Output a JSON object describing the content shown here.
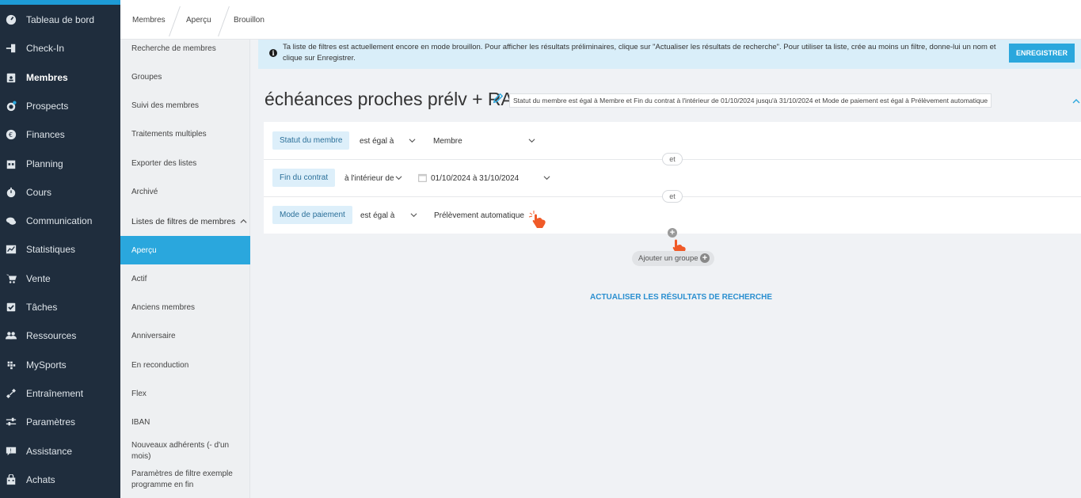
{
  "sidebar": {
    "items": [
      {
        "label": "Tableau de bord",
        "icon": "gauge-icon"
      },
      {
        "label": "Check-In",
        "icon": "login-icon"
      },
      {
        "label": "Membres",
        "icon": "id-card-icon",
        "active": true
      },
      {
        "label": "Prospects",
        "icon": "target-icon"
      },
      {
        "label": "Finances",
        "icon": "euro-icon"
      },
      {
        "label": "Planning",
        "icon": "calendar-icon"
      },
      {
        "label": "Cours",
        "icon": "stopwatch-icon"
      },
      {
        "label": "Communication",
        "icon": "chat-icon"
      },
      {
        "label": "Statistiques",
        "icon": "chart-icon"
      },
      {
        "label": "Vente",
        "icon": "cart-icon"
      },
      {
        "label": "Tâches",
        "icon": "checkbox-icon"
      },
      {
        "label": "Ressources",
        "icon": "users-icon"
      },
      {
        "label": "MySports",
        "icon": "grid-icon"
      },
      {
        "label": "Entraînement",
        "icon": "dumbbell-icon"
      },
      {
        "label": "Paramètres",
        "icon": "sliders-icon"
      },
      {
        "label": "Assistance",
        "icon": "help-chat-icon"
      },
      {
        "label": "Achats",
        "icon": "bag-icon"
      }
    ]
  },
  "subnav": {
    "items": [
      {
        "label": "Recherche de membres"
      },
      {
        "label": "Groupes"
      },
      {
        "label": "Suivi des membres"
      },
      {
        "label": "Traitements multiples"
      },
      {
        "label": "Exporter des listes"
      },
      {
        "label": "Archivé"
      }
    ],
    "section_header": "Listes de filtres de membres",
    "lists": [
      {
        "label": "Aperçu",
        "active": true
      },
      {
        "label": "Actif"
      },
      {
        "label": "Anciens membres"
      },
      {
        "label": "Anniversaire"
      },
      {
        "label": "En reconduction"
      },
      {
        "label": "Flex"
      },
      {
        "label": "IBAN"
      },
      {
        "label": "Nouveaux adhérents (- d'un mois)"
      },
      {
        "label": "Paramètres de filtre exemple programme en fin"
      }
    ]
  },
  "breadcrumb": [
    "Membres",
    "Aperçu",
    "Brouillon"
  ],
  "info": {
    "text": "Ta liste de filtres est actuellement encore en mode brouillon. Pour afficher les résultats préliminaires, clique sur \"Actualiser les résultats de recherche\". Pour utiliser ta liste, crée au moins un filtre, donne-lui un nom et clique sur Enregistrer.",
    "save_label": "ENREGISTRER"
  },
  "page": {
    "title": "échéances proches prélv + RA",
    "summary": "Statut du membre est égal à Membre et Fin du contrat à l'intérieur de 01/10/2024 jusqu'à 31/10/2024 et Mode de paiement est égal à Prélèvement automatique"
  },
  "filters": [
    {
      "field": "Statut du membre",
      "operator": "est égal à",
      "value": "Membre"
    },
    {
      "field": "Fin du contrat",
      "operator": "à l'intérieur de",
      "value": "01/10/2024 à 31/10/2024"
    },
    {
      "field": "Mode de paiement",
      "operator": "est égal à",
      "value": "Prélèvement automatique"
    }
  ],
  "connector": "et",
  "add_group_label": "Ajouter un groupe",
  "refresh_label": "ACTUALISER LES RÉSULTATS DE RECHERCHE",
  "colors": {
    "sidebar_bg": "#1f2d3d",
    "accent": "#2aa7dd",
    "info_bg": "#d9eef9",
    "chip_bg": "#ddeffa",
    "cursor": "#f05a28"
  }
}
